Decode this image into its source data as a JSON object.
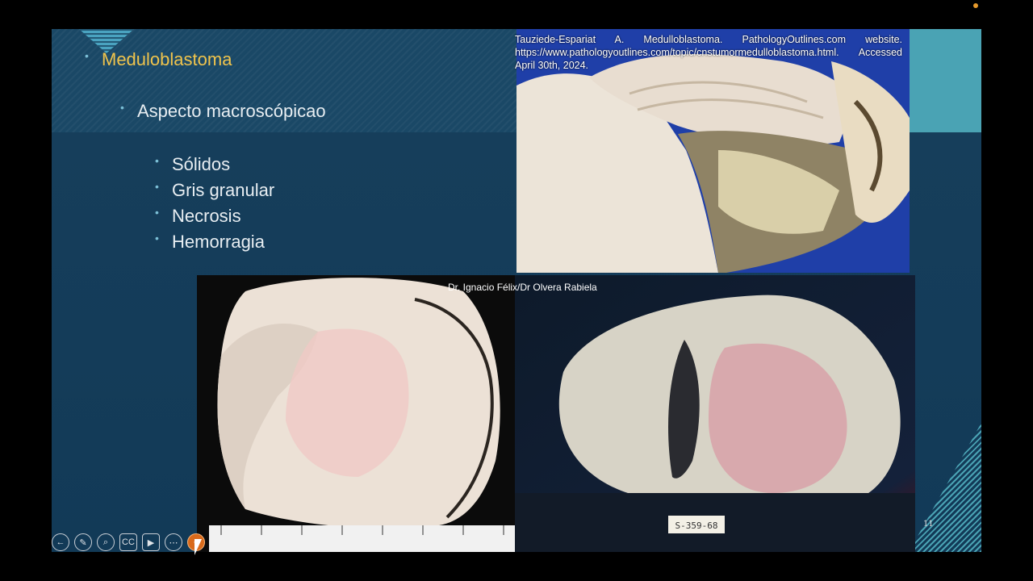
{
  "slide": {
    "title": "Meduloblastoma",
    "subtitle": "Aspecto macroscópicao",
    "items": [
      "Sólidos",
      "Gris granular",
      "Necrosis",
      "Hemorragia"
    ],
    "citation": "Tauziede-Espariat A. Medulloblastoma. PathologyOutlines.com website. https://www.pathologyoutlines.com/topic/cnstumormedulloblastoma.html. Accessed April 30th, 2024.",
    "photo_credit": "Dr. Ignacio Félix/Dr Olvera Rabiela",
    "slide_number": "11",
    "specimen_tag": "S-359-68"
  },
  "toolbar": {
    "buttons": [
      {
        "icon": "back-arrow-icon",
        "glyph": "←"
      },
      {
        "icon": "pen-icon",
        "glyph": "✎"
      },
      {
        "icon": "zoom-icon",
        "glyph": "⌕"
      },
      {
        "icon": "closed-caption-icon",
        "glyph": "CC"
      },
      {
        "icon": "video-camera-icon",
        "glyph": "▶"
      },
      {
        "icon": "more-icon",
        "glyph": "⋯"
      },
      {
        "icon": "laser-pointer-icon",
        "glyph": "●"
      }
    ]
  },
  "colors": {
    "background": "#123a57",
    "accent": "#4aa3b4",
    "title": "#f0c44c"
  }
}
